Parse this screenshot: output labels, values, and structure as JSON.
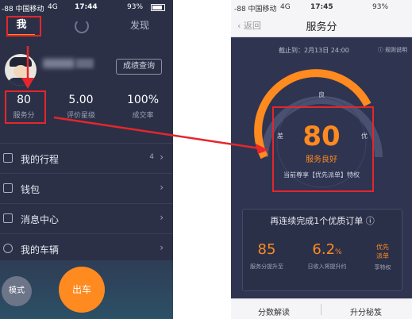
{
  "left_phone": {
    "status": {
      "carrier": "-88 中国移动",
      "network": "4G",
      "time": "17:44",
      "battery": "93%"
    },
    "tabs": {
      "me": "我",
      "discover": "发现"
    },
    "driver": {
      "score_button": "成绩查询"
    },
    "stats": [
      {
        "value": "80",
        "label": "服务分"
      },
      {
        "value": "5.00",
        "label": "评价星级"
      },
      {
        "value": "100%",
        "label": "成交率"
      }
    ],
    "menu": [
      {
        "label": "我的行程",
        "count": "4"
      },
      {
        "label": "钱包",
        "count": ""
      },
      {
        "label": "消息中心",
        "count": ""
      },
      {
        "label": "我的车辆",
        "count": ""
      }
    ],
    "bottom": {
      "mode": "模式",
      "go": "出车"
    }
  },
  "right_phone": {
    "status": {
      "carrier": "-88 中国移动",
      "network": "4G",
      "time": "17:45",
      "battery": "93%"
    },
    "header": {
      "back": "返回",
      "title": "服务分"
    },
    "date_line": "截止到：2月13日 24:00",
    "rules": "规则说明",
    "gauge": {
      "score": "80",
      "label": "服务良好",
      "privilege": "当前尊享【优先派单】特权",
      "ticks": [
        "良",
        "差",
        "优"
      ]
    },
    "card": {
      "title": "再连续完成1个优质订单",
      "kpis": [
        {
          "value": "85",
          "unit": "",
          "desc": "服务分提升至"
        },
        {
          "value": "6.2",
          "unit": "%",
          "desc": "日收入将提升约"
        }
      ],
      "badge": {
        "line1": "优先",
        "line2": "派单",
        "desc": "享特权"
      }
    },
    "footer": {
      "left": "分数解读",
      "right": "升分秘笈"
    }
  },
  "colors": {
    "accent": "#ff8a1f",
    "highlight_red": "#e5262b",
    "panel": "#2b3047"
  }
}
